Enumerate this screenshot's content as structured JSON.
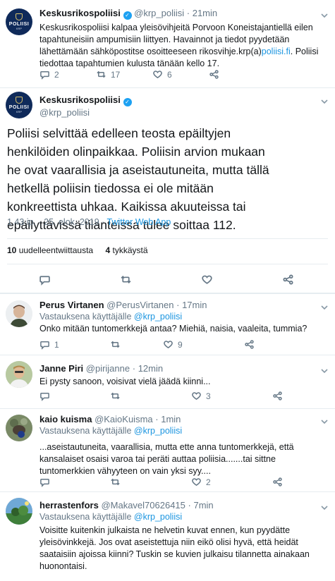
{
  "tweet1": {
    "name": "Keskusrikospoliisi",
    "handle": "@krp_poliisi",
    "time": "21min",
    "text_part1": "Keskusrikospoliisi kalpaa yleisövihjeitä Porvoon Koneistajantiellä eilen tapahtuneisiin ampumisiin liittyen. Havainnot ja tiedot pyydetään lähettämään sähköpostitse osoitteeseen rikosvihje.krp(a)",
    "text_link": "poliisi.fi",
    "text_part2": ". Poliisi tiedottaa tapahtumien kulusta tänään kello 17.",
    "replies": "2",
    "retweets": "17",
    "likes": "6"
  },
  "main": {
    "avatar_text": "POLIISI",
    "avatar_sub": "KRP",
    "name": "Keskusrikospoliisi",
    "handle": "@krp_poliisi",
    "text": "Poliisi selvittää edelleen teosta epäiltyjen henkilöiden olinpaikkaa. Poliisin arvion mukaan he ovat vaarallisia ja aseistautuneita, mutta tällä hetkellä poliisin tiedossa ei ole mitään konkreettista uhkaa. Kaikissa akuuteissa tai epäilyttävissä tilanteissa tulee soittaa 112.",
    "timestamp": "1.43 ip. · 25. elok. 2019 · ",
    "source": "Twitter Web App",
    "retweets_count": "10",
    "retweets_label": "uudelleentwiittausta",
    "likes_count": "4",
    "likes_label": "tykkäystä"
  },
  "replies": [
    {
      "name": "Perus Virtanen",
      "handle": "@PerusVirtanen",
      "time": "17min",
      "reply_to_label": "Vastauksena käyttäjälle ",
      "reply_to": "@krp_poliisi",
      "text": "Onko mitään tuntomerkkejä antaa? Miehiä, naisia, vaaleita, tummia?",
      "replies": "1",
      "retweets": "",
      "likes": "9"
    },
    {
      "name": "Janne Piri",
      "handle": "@pirijanne",
      "time": "12min",
      "text": "Ei pysty sanoon, voisivat vielä jäädä kiinni...",
      "replies": "",
      "retweets": "",
      "likes": "3"
    },
    {
      "name": "kaio kuisma",
      "handle": "@KaioKuisma",
      "time": "1min",
      "reply_to_label": "Vastauksena käyttäjälle ",
      "reply_to": "@krp_poliisi",
      "text": "...aseistautuneita, vaarallisia, mutta ette anna tuntomerkkejä, että kansalaiset osaisi varoa tai peräti auttaa poliisia.......tai sittne tuntomerkkien vähyyteen on vain yksi syy....",
      "replies": "",
      "retweets": "",
      "likes": "2"
    },
    {
      "name": "herrastenfors",
      "handle": "@Makavel70626415",
      "time": "7min",
      "reply_to_label": "Vastauksena käyttäjälle ",
      "reply_to": "@krp_poliisi",
      "text": "Voisitte kuitenkin julkaista ne helvetin kuvat ennen, kun pyydätte yleisövinkkejä. Jos ovat aseistettuja niin eikö olisi hyvä, että heidät saataisiin ajoissa kiinni? Tuskin se kuvien julkaisu tilannetta ainakaan huonontaisi."
    }
  ],
  "colors": {
    "link": "#1b95e0",
    "muted": "#657786",
    "police_blue": "#0f2a5a"
  }
}
